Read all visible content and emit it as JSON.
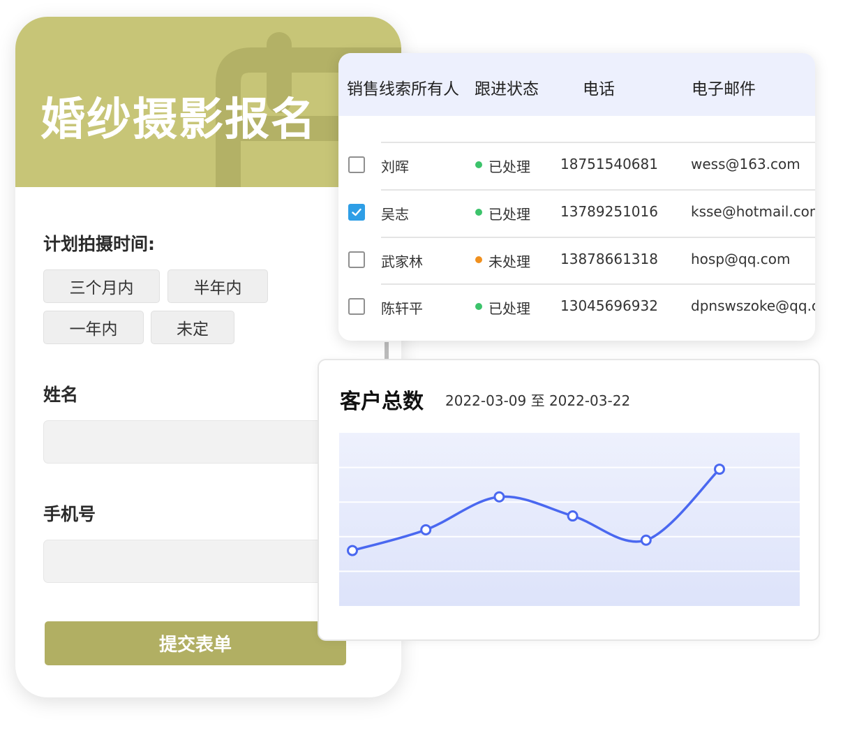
{
  "form": {
    "title": "婚纱摄影报名",
    "shoot_time_label": "计划拍摄时间:",
    "shoot_time_options": [
      "三个月内",
      "半年内",
      "一年内",
      "未定"
    ],
    "name_label": "姓名",
    "phone_label": "手机号",
    "submit_label": "提交表单",
    "colors": {
      "header": "#c7c577",
      "submit": "#b1af63"
    }
  },
  "leads_table": {
    "columns": [
      "销售线索所有人",
      "跟进状态",
      "电话",
      "电子邮件"
    ],
    "rows": [
      {
        "checked": false,
        "owner": "刘晖",
        "status": "已处理",
        "status_color": "#3cc36b",
        "phone": "18751540681",
        "email": "wess@163.com"
      },
      {
        "checked": true,
        "owner": "吴志",
        "status": "已处理",
        "status_color": "#3cc36b",
        "phone": "13789251016",
        "email": "ksse@hotmail.com"
      },
      {
        "checked": false,
        "owner": "武家林",
        "status": "未处理",
        "status_color": "#f0901e",
        "phone": "13878661318",
        "email": "hosp@qq.com"
      },
      {
        "checked": false,
        "owner": "陈轩平",
        "status": "已处理",
        "status_color": "#3cc36b",
        "phone": "13045696932",
        "email": "dpnswszoke@qq.com"
      }
    ]
  },
  "customer_chart": {
    "title": "客户总数",
    "date_range": "2022-03-09 至 2022-03-22",
    "line_color": "#4a68f0"
  },
  "chart_data": {
    "type": "line",
    "x": [
      1,
      2,
      3,
      4,
      5,
      6
    ],
    "values": [
      1.6,
      2.2,
      3.15,
      2.6,
      1.9,
      3.95
    ],
    "ylim": [
      0,
      5
    ],
    "grid": true,
    "title": "客户总数",
    "xlabel": "",
    "ylabel": ""
  }
}
